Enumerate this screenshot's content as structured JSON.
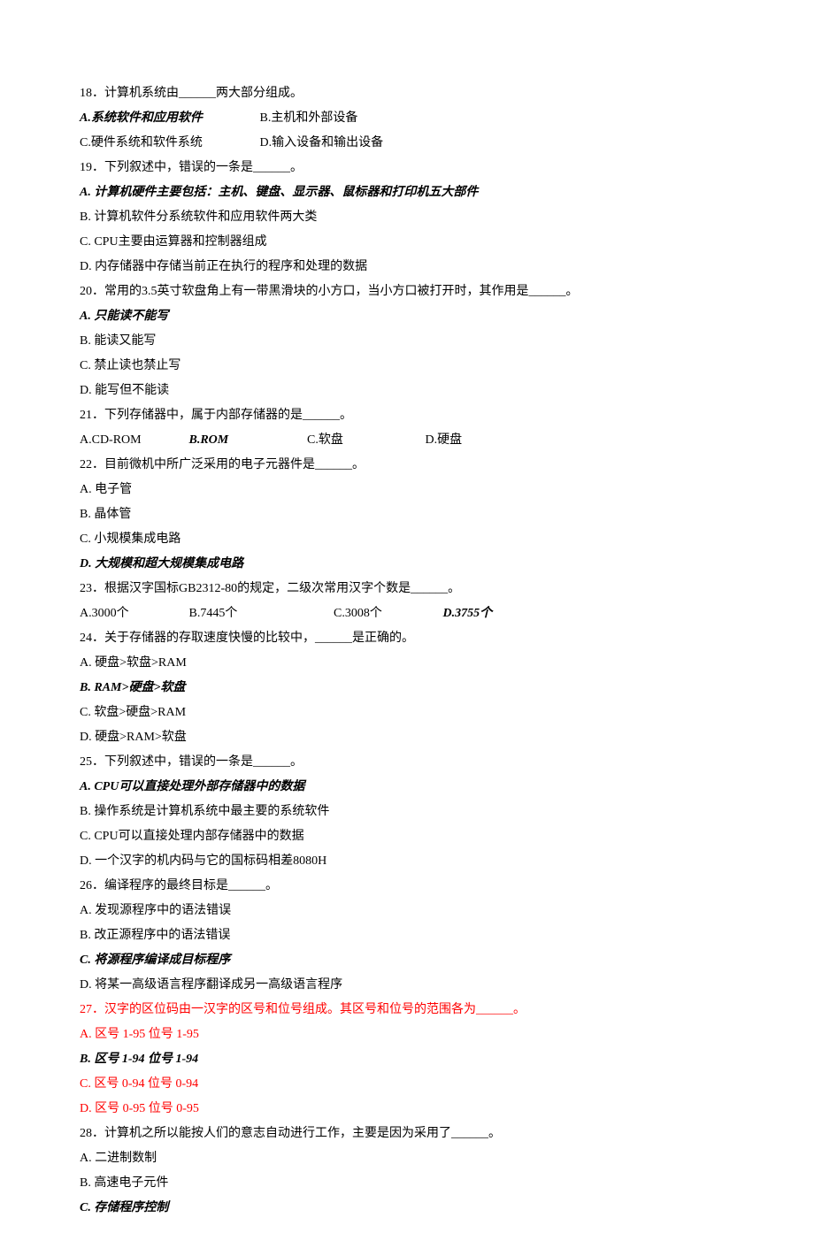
{
  "q18": {
    "stem": "18．计算机系统由______两大部分组成。",
    "optA": "A.系统软件和应用软件",
    "optB": "B.主机和外部设备",
    "optC": "C.硬件系统和软件系统",
    "optD": "D.输入设备和输出设备"
  },
  "q19": {
    "stem": "19．下列叙述中，错误的一条是______。",
    "optA": "A.   计算机硬件主要包括：主机、键盘、显示器、鼠标器和打印机五大部件",
    "optB": "B.   计算机软件分系统软件和应用软件两大类",
    "optC": "C.   CPU主要由运算器和控制器组成",
    "optD": "D.   内存储器中存储当前正在执行的程序和处理的数据"
  },
  "q20": {
    "stem": "20．常用的3.5英寸软盘角上有一带黑滑块的小方口，当小方口被打开时，其作用是______。",
    "optA": "A.   只能读不能写",
    "optB": "B.   能读又能写",
    "optC": "C.   禁止读也禁止写",
    "optD": "D.   能写但不能读"
  },
  "q21": {
    "stem": "21．下列存储器中，属于内部存储器的是______。",
    "optA": "A.CD-ROM",
    "optB": "B.ROM",
    "optC": "C.软盘",
    "optD": "D.硬盘"
  },
  "q22": {
    "stem": "22．目前微机中所广泛采用的电子元器件是______。",
    "optA": "A.   电子管",
    "optB": "B.   晶体管",
    "optC": "C.   小规模集成电路",
    "optD": "D.   大规模和超大规模集成电路"
  },
  "q23": {
    "stem": "23．根据汉字国标GB2312-80的规定，二级次常用汉字个数是______。",
    "optA": "A.3000个",
    "optB": "B.7445个",
    "optC": "C.3008个",
    "optD": "D.3755个"
  },
  "q24": {
    "stem": "24．关于存储器的存取速度快慢的比较中，______是正确的。",
    "optA": "A.   硬盘>软盘>RAM",
    "optB": "B.   RAM>硬盘>软盘",
    "optC": "C.   软盘>硬盘>RAM",
    "optD": "D.   硬盘>RAM>软盘"
  },
  "q25": {
    "stem": "25．下列叙述中，错误的一条是______。",
    "optA": "A.   CPU可以直接处理外部存储器中的数据",
    "optB": "B.   操作系统是计算机系统中最主要的系统软件",
    "optC": "C.   CPU可以直接处理内部存储器中的数据",
    "optD": "D.   一个汉字的机内码与它的国标码相差8080H"
  },
  "q26": {
    "stem": "26．编译程序的最终目标是______。",
    "optA": "A.   发现源程序中的语法错误",
    "optB": "B.   改正源程序中的语法错误",
    "optC": "C.   将源程序编译成目标程序",
    "optD": "D.   将某一高级语言程序翻译成另一高级语言程序"
  },
  "q27": {
    "stem": "27．汉字的区位码由一汉字的区号和位号组成。其区号和位号的范围各为______。",
    "optA": "A.   区号 1-95 位号 1-95",
    "optB": "B.   区号 1-94 位号 1-94",
    "optC": "C.   区号 0-94 位号 0-94",
    "optD": "D.   区号 0-95 位号 0-95"
  },
  "q28": {
    "stem": "28．计算机之所以能按人们的意志自动进行工作，主要是因为采用了______。",
    "optA": "A.   二进制数制",
    "optB": "B.   高速电子元件",
    "optC": "C.   存储程序控制"
  }
}
